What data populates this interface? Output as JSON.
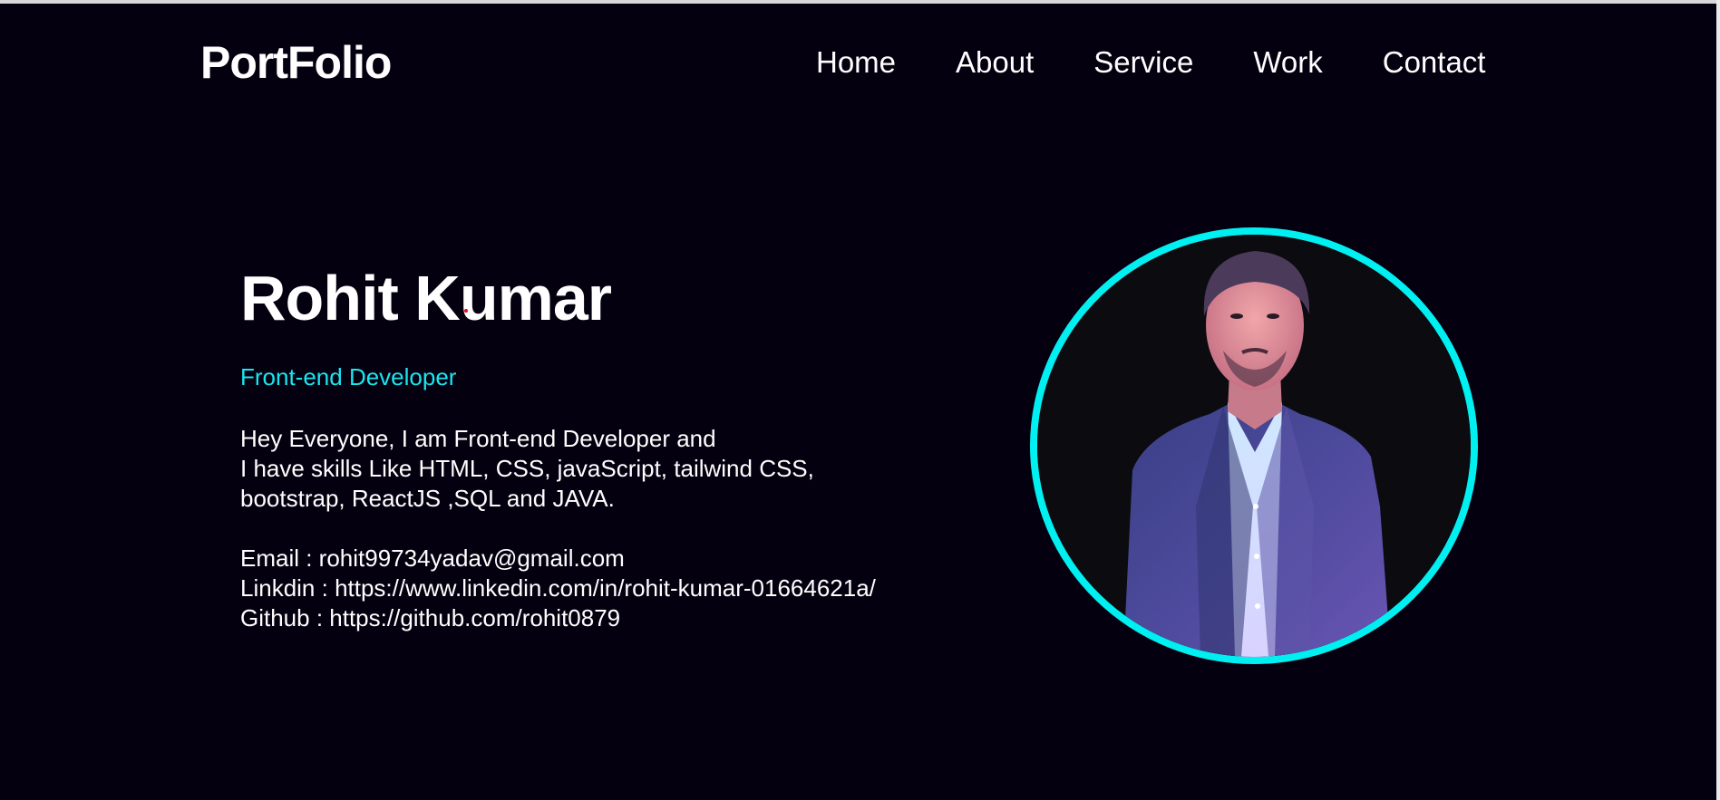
{
  "header": {
    "logo": "PortFolio",
    "nav": [
      "Home",
      "About",
      "Service",
      "Work",
      "Contact"
    ]
  },
  "hero": {
    "name": "Rohit Kumar",
    "role": "Front-end Developer",
    "intro_lines": [
      "Hey Everyone, I am Front-end Developer and",
      "I have skills Like HTML, CSS, javaScript, tailwind CSS,",
      "bootstrap, ReactJS ,SQL and JAVA."
    ],
    "contact_lines": [
      "Email : rohit99734yadav@gmail.com",
      "Linkdin : https://www.linkedin.com/in/rohit-kumar-01664621a/",
      "Github : https://github.com/rohit0879"
    ]
  },
  "colors": {
    "background": "#04000f",
    "accent": "#19e6ef",
    "ring": "#00f0f2",
    "text": "#ffffff"
  },
  "photo": {
    "alt_icon": "profile-photo"
  }
}
